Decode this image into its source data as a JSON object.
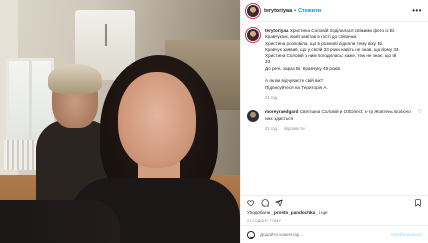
{
  "header": {
    "username": "terytoriyaa",
    "separator": "•",
    "follow_label": "Стежити",
    "more_label": "•••"
  },
  "caption": {
    "username": "terytoriyaa",
    "lines": [
      "Христина Соловій поділилася свіжими фото із Ві.",
      "Кравчуком, який завітав в гості до співачки.",
      "Христина розповіла, що в розмові підняли тему віку. Ві.",
      "Кравчук заявив, що у своїй 33 роки навіть не знав, що йому 33.",
      "Христина Соловій з ним погодилась; каже, теж не знає, що їй",
      "33.",
      "До речі, зараз Ві. Кравчуку 49 років.",
      "",
      "А як ви відчуваєте свій вік?",
      "Підписуйтеся на Територія А."
    ],
    "time": "21 год."
  },
  "comment": {
    "username": "moreyraedgard",
    "text": "Светлана Соловій и OSDirect; к-тр Жовтень Болючо нікє здається",
    "time": "21 год.",
    "reply_label": "Відповісти"
  },
  "likes": {
    "prefix": "Уподобали",
    "user": "_prosto_pandochka_",
    "suffix": "і ще"
  },
  "date": "21 ГОДИНУ ТОМУ",
  "add_comment": {
    "placeholder": "Додайте коментар...",
    "publish_label": "Опублікувати"
  },
  "icons": [
    "heart-icon",
    "comment-icon",
    "share-icon",
    "bookmark-icon",
    "emoji-icon",
    "more-icon"
  ],
  "colors": {
    "accent": "#0095f6",
    "text": "#262626",
    "muted": "#8e8e8e"
  }
}
